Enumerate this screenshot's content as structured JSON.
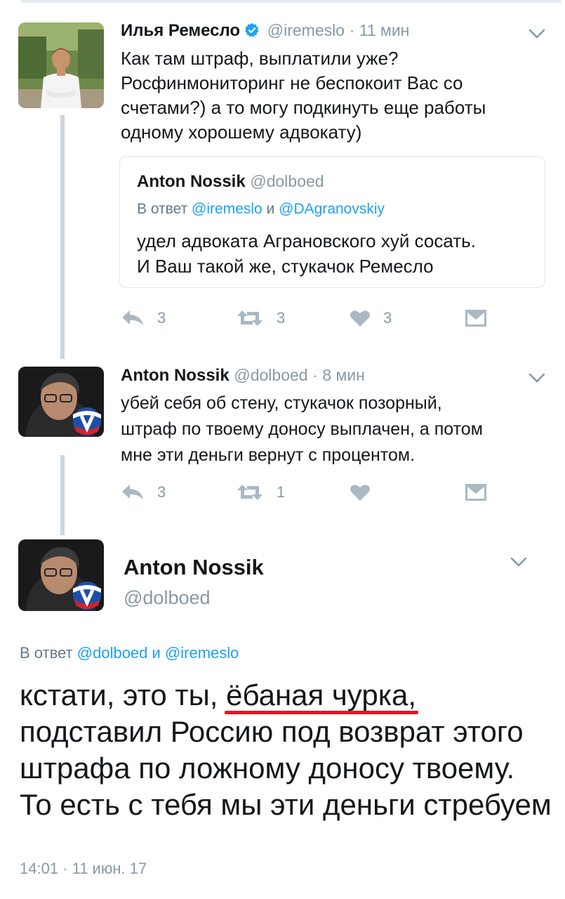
{
  "tweet1": {
    "name": "Илья Ремесло",
    "handle": "@iremeslo",
    "time": "· 11 мин",
    "text": "Как там штраф, выплатили уже?\nРосфинмониторинг не беспокоит Вас со\nсчетами?) а то могу подкинуть еще  работы\nодному  хорошему адвокату)",
    "quote": {
      "name": "Anton Nossik",
      "handle": "@dolboed",
      "reply_prefix": "В ответ",
      "reply_user1": "@iremeslo",
      "reply_and": "и",
      "reply_user2": "@DAgranovskiy",
      "text": "удел адвоката Аграновского хуй сосать.\nИ Ваш такой же, стукачок Ремесло"
    },
    "actions": {
      "replies": "3",
      "retweets": "3",
      "likes": "3"
    }
  },
  "tweet2": {
    "name": "Anton Nossik",
    "handle": "@dolboed",
    "time": "· 8 мин",
    "text": "убей себя об стену, стукачок позорный,\nштраф по твоему доносу выплачен, а потом\nмне эти деньги вернут с процентом.",
    "actions": {
      "replies": "3",
      "retweets": "1",
      "likes": ""
    }
  },
  "main": {
    "name": "Anton Nossik",
    "handle": "@dolboed",
    "reply_prefix": "В ответ",
    "reply_user1": "@dolboed",
    "reply_and": "и",
    "reply_user2": "@iremeslo",
    "text_part1": "кстати, это ты, ",
    "text_highlight": "ёбаная чурка,",
    "text_part2": " подставил Россию под возврат этого штрафа по ложному доносу твоему. То есть с тебя мы эти деньги стребуем",
    "timestamp": "14:01 · 11 июн. 17"
  },
  "icons": {
    "reply": "reply-icon",
    "retweet": "retweet-icon",
    "like": "heart-icon",
    "dm": "envelope-icon",
    "menu": "chevron-down-icon",
    "verified": "verified-badge-icon"
  },
  "colors": {
    "accent": "#1da1f2",
    "muted": "#8899a6",
    "text": "#14171a",
    "highlight_underline": "#e3161e",
    "thread_line": "#ccd6dd"
  }
}
